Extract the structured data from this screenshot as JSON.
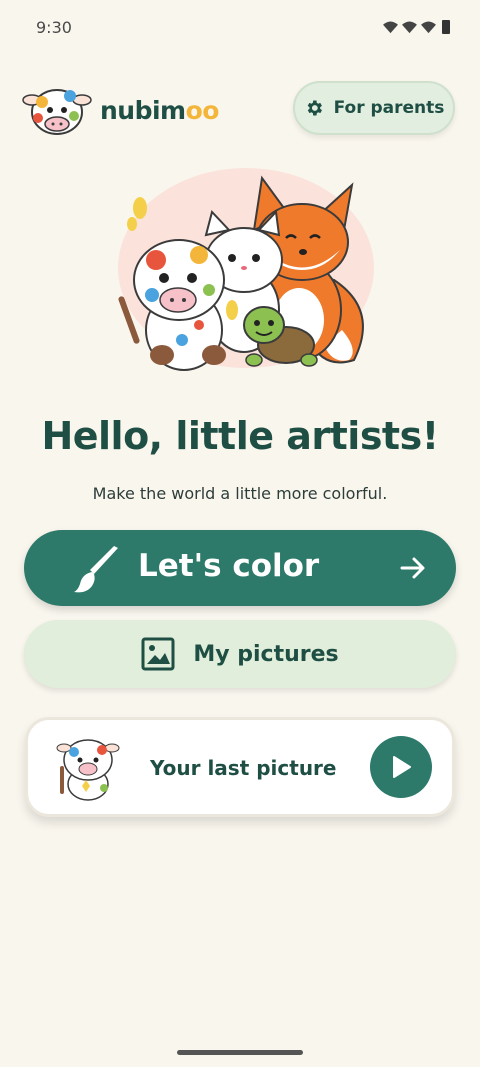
{
  "status_bar": {
    "time": "9:30",
    "icons": [
      "wifi-icon",
      "wifi-icon",
      "wifi-icon",
      "battery-icon"
    ]
  },
  "header": {
    "logo_text_main": "nubim",
    "logo_text_accent": "oo",
    "parents_button_label": "For parents",
    "parents_icon": "gear-icon"
  },
  "hero": {
    "illustration": "cow-cat-fox-turtle-illustration"
  },
  "main": {
    "title": "Hello, little artists!",
    "subtitle": "Make the world a little more colorful."
  },
  "actions": {
    "color_label": "Let's color",
    "color_icon": "paintbrush-icon",
    "color_arrow": "arrow-right-icon",
    "pictures_label": "My pictures",
    "pictures_icon": "image-icon"
  },
  "last_picture": {
    "label": "Your last picture",
    "play_icon": "play-icon"
  },
  "colors": {
    "background": "#f9f6ee",
    "primary": "#2d7a6a",
    "primary_text": "#1f4f44",
    "soft_green": "#e0eedb",
    "accent_yellow": "#f4b63a"
  }
}
